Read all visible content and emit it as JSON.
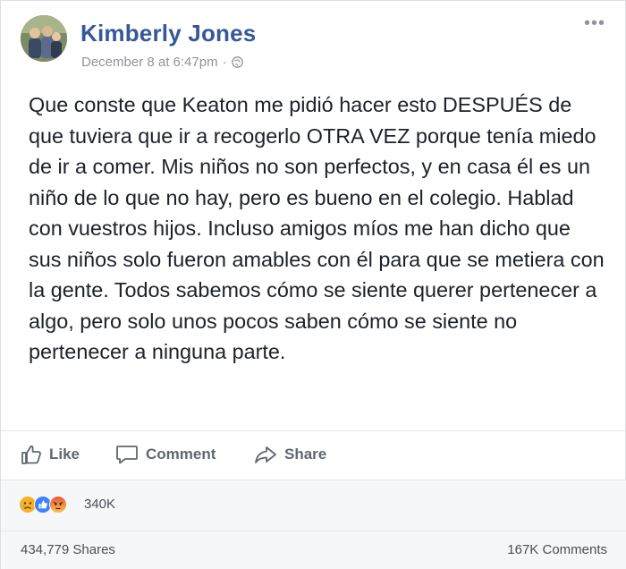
{
  "post": {
    "author": "Kimberly Jones",
    "timestamp": "December 8 at 6:47pm",
    "separator": "·",
    "privacy_icon": "globe-icon",
    "more_icon": "•••",
    "text": "Que conste que Keaton me pidió hacer esto DESPUÉS de que tuviera que ir a recogerlo OTRA VEZ porque tenía miedo de ir a comer. Mis niños no son perfectos, y en casa él es un niño de lo que no hay, pero es bueno en el colegio. Hablad con vuestros hijos. Incluso amigos míos me han dicho que sus niños solo fueron amables con él para que se metiera con la gente. Todos sabemos cómo se siente querer pertenecer a algo, pero solo unos pocos saben cómo se siente no pertenecer a ninguna parte."
  },
  "actions": {
    "like": "Like",
    "comment": "Comment",
    "share": "Share"
  },
  "reactions": {
    "icons": [
      "sad-emoji",
      "like-emoji",
      "angry-emoji"
    ],
    "count": "340K"
  },
  "footer": {
    "shares": "434,779 Shares",
    "comments": "167K Comments"
  },
  "colors": {
    "author": "#365899",
    "meta": "#90949c",
    "action": "#606770",
    "like_blue": "#4080ff",
    "sad_yellow": "#f7b125",
    "angry_red": "#e9573e"
  }
}
